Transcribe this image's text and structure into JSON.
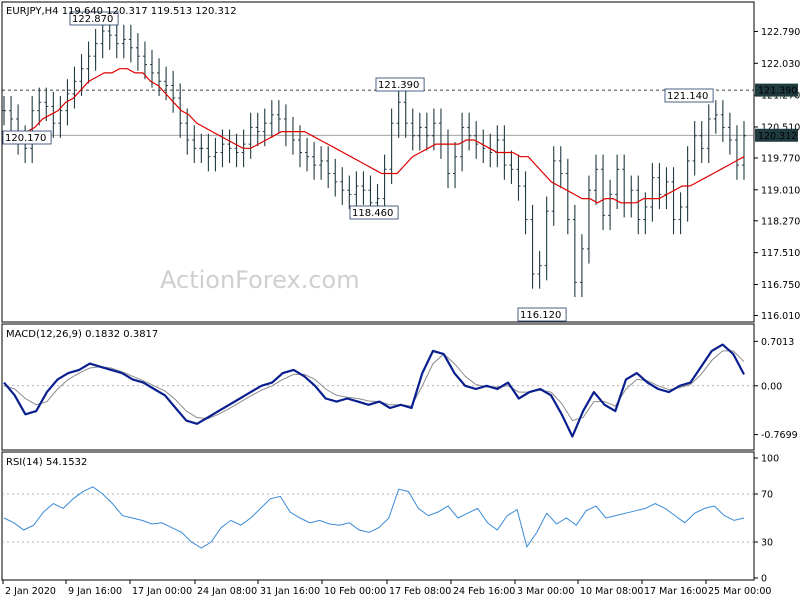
{
  "colors": {
    "candles": "#1f3b40",
    "ma": "#e00000",
    "macd": "#0a1f8f",
    "signal": "#8c8c8c",
    "rsi": "#3a8ad6",
    "level": "#808080",
    "price_tag_bg": "#1f3b40"
  },
  "watermark": "ActionForex.com",
  "chart_data": [
    {
      "type": "candlestick",
      "title": "EURJPY,H4  119.640 120.317 119.513 120.312",
      "symbol": "EURJPY",
      "timeframe": "H4",
      "ohlc": {
        "open": 119.64,
        "high": 120.317,
        "low": 119.513,
        "close": 120.312
      },
      "yticks": [
        "122.790",
        "122.030",
        "121.270",
        "120.510",
        "119.770",
        "119.010",
        "118.270",
        "117.510",
        "116.750",
        "116.010"
      ],
      "ylim": [
        115.95,
        123.35
      ],
      "current_price_label": "120.312",
      "resistance_label": "121.390",
      "annotations": [
        "122.870",
        "121.390",
        "121.140",
        "120.170",
        "118.460",
        "116.120"
      ],
      "series": [
        {
          "name": "close",
          "values": [
            120.9,
            120.7,
            120.2,
            120.0,
            120.9,
            121.1,
            121.0,
            120.6,
            120.9,
            121.3,
            121.6,
            121.9,
            122.2,
            122.5,
            122.8,
            122.7,
            122.5,
            122.6,
            122.4,
            122.2,
            122.0,
            121.8,
            121.6,
            121.5,
            121.2,
            120.6,
            120.2,
            120.0,
            120.0,
            119.8,
            119.9,
            120.1,
            120.0,
            119.9,
            120.1,
            120.5,
            120.4,
            120.6,
            120.8,
            120.7,
            120.4,
            120.2,
            119.9,
            119.8,
            119.6,
            119.7,
            119.4,
            119.2,
            119.0,
            118.9,
            119.1,
            119.0,
            118.7,
            118.8,
            119.5,
            120.6,
            121.1,
            120.6,
            120.3,
            120.5,
            120.3,
            120.6,
            120.1,
            119.4,
            119.8,
            120.5,
            120.3,
            120.1,
            120.0,
            119.9,
            120.2,
            119.6,
            119.5,
            119.1,
            118.3,
            117.0,
            117.2,
            118.5,
            119.7,
            119.4,
            118.3,
            116.8,
            117.6,
            119.0,
            119.5,
            118.4,
            118.9,
            119.5,
            118.7,
            119.0,
            118.3,
            118.6,
            119.3,
            118.9,
            119.2,
            118.3,
            118.6,
            119.7,
            120.3,
            120.0,
            120.7,
            120.8,
            120.5,
            120.2,
            119.6,
            120.3
          ]
        },
        {
          "name": "MA",
          "values": [
            120.4,
            120.3,
            120.3,
            120.4,
            120.5,
            120.7,
            120.8,
            120.9,
            121.1,
            121.2,
            121.4,
            121.6,
            121.7,
            121.8,
            121.8,
            121.9,
            121.9,
            121.8,
            121.8,
            121.6,
            121.5,
            121.3,
            121.1,
            120.9,
            120.8,
            120.6,
            120.5,
            120.4,
            120.3,
            120.2,
            120.1,
            120.0,
            120.0,
            120.1,
            120.2,
            120.3,
            120.4,
            120.4,
            120.4,
            120.4,
            120.3,
            120.2,
            120.1,
            120.0,
            119.9,
            119.8,
            119.7,
            119.6,
            119.5,
            119.4,
            119.4,
            119.4,
            119.6,
            119.8,
            119.9,
            120.0,
            120.1,
            120.1,
            120.1,
            120.1,
            120.2,
            120.2,
            120.1,
            120.0,
            119.9,
            119.9,
            119.9,
            119.8,
            119.8,
            119.6,
            119.4,
            119.2,
            119.1,
            119.0,
            118.9,
            118.8,
            118.8,
            118.7,
            118.8,
            118.8,
            118.7,
            118.7,
            118.7,
            118.8,
            118.8,
            118.8,
            118.9,
            119.0,
            119.1,
            119.1,
            119.2,
            119.3,
            119.4,
            119.5,
            119.6,
            119.7,
            119.8
          ]
        }
      ]
    },
    {
      "type": "line",
      "title": "MACD(12,26,9) 0.1832 0.3817",
      "yticks": [
        "0.7013",
        "0.00",
        "-0.7699"
      ],
      "ylim": [
        -0.95,
        0.88
      ],
      "series": [
        {
          "name": "MACD",
          "values": [
            0.05,
            -0.15,
            -0.45,
            -0.4,
            -0.1,
            0.1,
            0.2,
            0.25,
            0.35,
            0.3,
            0.25,
            0.2,
            0.1,
            0.05,
            -0.05,
            -0.15,
            -0.35,
            -0.55,
            -0.6,
            -0.5,
            -0.4,
            -0.3,
            -0.2,
            -0.1,
            0.0,
            0.05,
            0.2,
            0.25,
            0.15,
            0.0,
            -0.2,
            -0.25,
            -0.2,
            -0.25,
            -0.3,
            -0.25,
            -0.35,
            -0.3,
            -0.35,
            0.2,
            0.55,
            0.5,
            0.2,
            0.0,
            -0.05,
            0.0,
            -0.05,
            0.05,
            -0.2,
            -0.1,
            -0.05,
            -0.15,
            -0.45,
            -0.8,
            -0.4,
            -0.1,
            -0.3,
            -0.4,
            0.1,
            0.2,
            0.05,
            -0.05,
            -0.1,
            0.0,
            0.05,
            0.3,
            0.55,
            0.65,
            0.5,
            0.18
          ]
        },
        {
          "name": "Signal",
          "values": [
            0.0,
            -0.05,
            -0.2,
            -0.3,
            -0.25,
            -0.05,
            0.1,
            0.2,
            0.28,
            0.3,
            0.28,
            0.22,
            0.15,
            0.08,
            0.0,
            -0.08,
            -0.22,
            -0.4,
            -0.5,
            -0.52,
            -0.45,
            -0.36,
            -0.26,
            -0.16,
            -0.07,
            0.0,
            0.1,
            0.18,
            0.18,
            0.1,
            -0.05,
            -0.15,
            -0.18,
            -0.2,
            -0.24,
            -0.25,
            -0.3,
            -0.3,
            -0.32,
            0.0,
            0.35,
            0.5,
            0.35,
            0.15,
            0.02,
            -0.02,
            -0.02,
            0.0,
            -0.1,
            -0.1,
            -0.07,
            -0.1,
            -0.28,
            -0.55,
            -0.5,
            -0.25,
            -0.25,
            -0.32,
            -0.05,
            0.1,
            0.08,
            0.0,
            -0.06,
            -0.03,
            0.02,
            0.18,
            0.4,
            0.55,
            0.55,
            0.38
          ]
        }
      ]
    },
    {
      "type": "line",
      "title": "RSI(14) 54.1532",
      "yticks": [
        "100",
        "70",
        "30",
        "0"
      ],
      "ylim": [
        0,
        100
      ],
      "levels": [
        70,
        30
      ],
      "series": [
        {
          "name": "RSI",
          "values": [
            50,
            46,
            40,
            44,
            55,
            62,
            58,
            66,
            72,
            76,
            70,
            62,
            52,
            50,
            48,
            45,
            46,
            42,
            38,
            30,
            25,
            30,
            42,
            48,
            44,
            50,
            58,
            66,
            68,
            55,
            50,
            46,
            48,
            45,
            44,
            46,
            40,
            38,
            42,
            50,
            74,
            72,
            58,
            52,
            55,
            60,
            50,
            54,
            58,
            46,
            40,
            52,
            57,
            26,
            38,
            54,
            45,
            50,
            44,
            56,
            60,
            50,
            52,
            54,
            56,
            58,
            62,
            58,
            52,
            46,
            54,
            58,
            60,
            52,
            48,
            50
          ]
        }
      ]
    },
    {
      "type": "axis",
      "xticks": [
        "2 Jan 2020",
        "9 Jan 16:00",
        "17 Jan 00:00",
        "24 Jan 08:00",
        "31 Jan 16:00",
        "10 Feb 00:00",
        "17 Feb 08:00",
        "24 Feb 16:00",
        "3 Mar 00:00",
        "10 Mar 08:00",
        "17 Mar 16:00",
        "25 Mar 00:00"
      ]
    }
  ]
}
